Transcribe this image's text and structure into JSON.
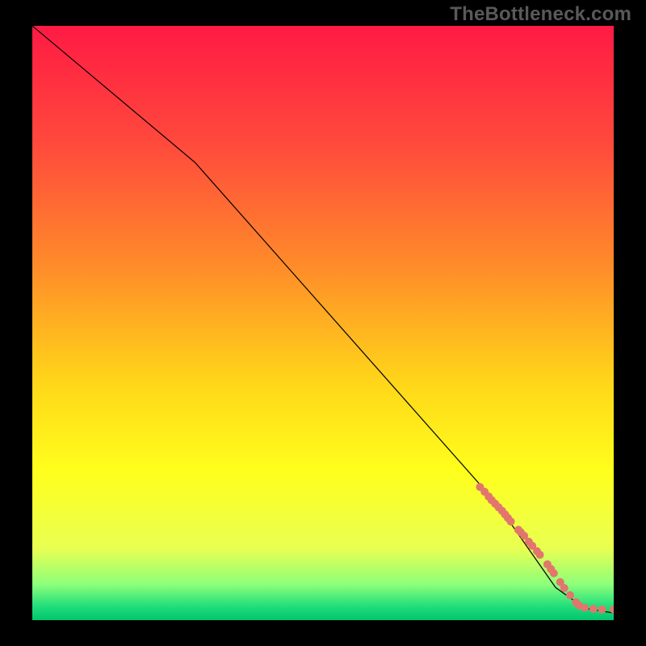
{
  "watermark": "TheBottleneck.com",
  "chart_data": {
    "type": "line",
    "title": "",
    "xlabel": "",
    "ylabel": "",
    "xlim": [
      0,
      100
    ],
    "ylim": [
      0,
      100
    ],
    "grid": false,
    "legend": false,
    "background_gradient": {
      "stops": [
        {
          "offset": 0.0,
          "color": "#ff1a44"
        },
        {
          "offset": 0.2,
          "color": "#ff4a3c"
        },
        {
          "offset": 0.4,
          "color": "#ff8a2a"
        },
        {
          "offset": 0.6,
          "color": "#ffd619"
        },
        {
          "offset": 0.75,
          "color": "#ffff1c"
        },
        {
          "offset": 0.88,
          "color": "#e8ff52"
        },
        {
          "offset": 0.94,
          "color": "#8dff7a"
        },
        {
          "offset": 0.975,
          "color": "#25e07c"
        },
        {
          "offset": 1.0,
          "color": "#00c46d"
        }
      ]
    },
    "series": [
      {
        "name": "bottleneck-curve",
        "type": "line",
        "stroke": "#000000",
        "stroke_width": 1.2,
        "x": [
          0.0,
          28.0,
          80.0,
          90.0,
          95.0,
          100.0
        ],
        "y": [
          100.0,
          77.0,
          19.5,
          5.5,
          2.0,
          1.2
        ]
      },
      {
        "name": "observed-points",
        "type": "scatter",
        "marker_color": "#e2766d",
        "marker_radius": 5,
        "x": [
          77.0,
          77.8,
          78.5,
          79.0,
          79.6,
          80.2,
          80.8,
          81.3,
          81.8,
          82.3,
          83.6,
          84.0,
          84.6,
          85.4,
          86.0,
          86.8,
          87.3,
          88.6,
          89.2,
          89.7,
          90.8,
          91.5,
          92.5,
          93.5,
          94.0,
          95.0,
          96.5,
          98.0,
          100.0
        ],
        "y": [
          22.4,
          21.6,
          20.8,
          20.2,
          19.6,
          19.0,
          18.4,
          17.8,
          17.2,
          16.6,
          15.2,
          14.8,
          14.2,
          13.2,
          12.5,
          11.6,
          11.0,
          9.4,
          8.6,
          7.9,
          6.4,
          5.4,
          4.2,
          3.0,
          2.5,
          2.1,
          1.9,
          1.8,
          1.8
        ]
      }
    ]
  }
}
